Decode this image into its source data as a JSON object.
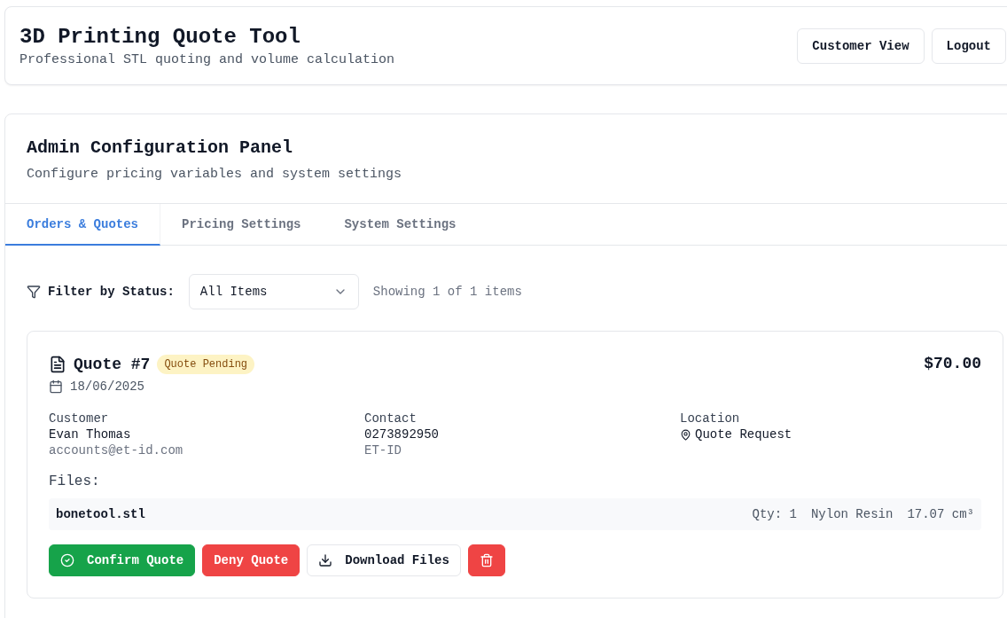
{
  "header": {
    "title": "3D Printing Quote Tool",
    "subtitle": "Professional STL quoting and volume calculation",
    "buttons": [
      {
        "label": "Customer View"
      },
      {
        "label": "Logout"
      }
    ]
  },
  "panel": {
    "title": "Admin Configuration Panel",
    "subtitle": "Configure pricing variables and system settings",
    "tabs": [
      {
        "label": "Orders & Quotes",
        "selected": true
      },
      {
        "label": "Pricing Settings",
        "selected": false
      },
      {
        "label": "System Settings",
        "selected": false
      }
    ],
    "filter": {
      "label": "Filter by Status:",
      "value": "All Items",
      "count": "Showing 1 of 1 items"
    },
    "orders": [
      {
        "title": "Quote #7",
        "status": "Quote Pending",
        "date": "18/06/2025",
        "total": "$70.00",
        "customer": {
          "label": "Customer",
          "name": "Evan Thomas",
          "email": "accounts@et-id.com"
        },
        "contact": {
          "label": "Contact",
          "phone": "0273892950",
          "company": "ET-ID"
        },
        "location": {
          "label": "Location",
          "value": "Quote Request"
        },
        "files_label": "Files:",
        "files": [
          {
            "name": "bonetool.stl",
            "qty": "Qty: 1",
            "material": "Nylon Resin",
            "volume": "17.07 cm³"
          }
        ],
        "actions": [
          {
            "kind": "confirm",
            "label": "Confirm Quote"
          },
          {
            "kind": "deny",
            "label": "Deny Quote"
          },
          {
            "kind": "download",
            "label": "Download Files"
          },
          {
            "kind": "delete"
          }
        ]
      }
    ]
  }
}
